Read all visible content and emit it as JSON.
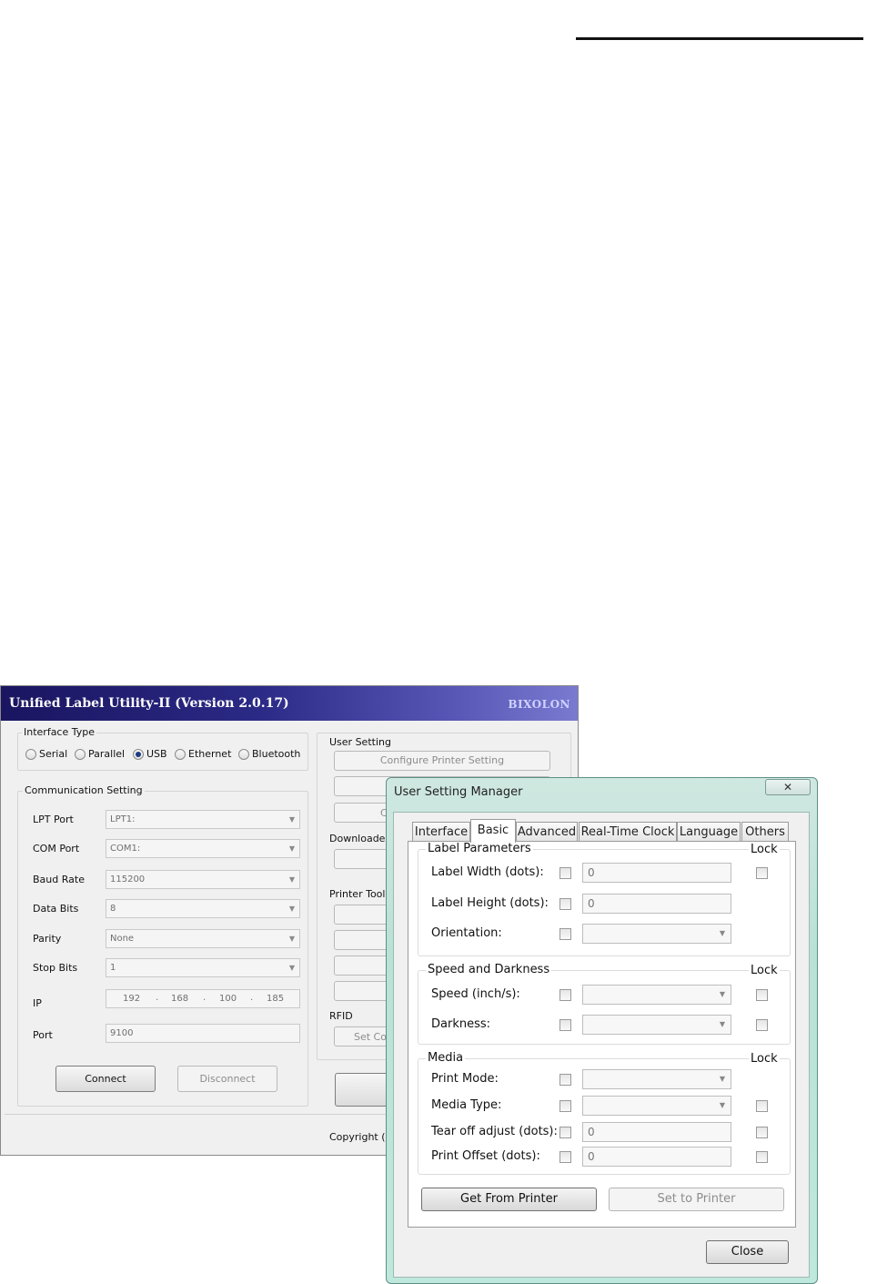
{
  "main_window": {
    "title": "Unified Label Utility-II (Version 2.0.17)",
    "brand": "BIXOLON",
    "interface_type": {
      "label": "Interface Type",
      "options": [
        "Serial",
        "Parallel",
        "USB",
        "Ethernet",
        "Bluetooth"
      ],
      "selected": "USB"
    },
    "communication": {
      "label": "Communication Setting",
      "lpt_port": {
        "label": "LPT Port",
        "value": "LPT1:"
      },
      "com_port": {
        "label": "COM Port",
        "value": "COM1:"
      },
      "baud_rate": {
        "label": "Baud Rate",
        "value": "115200"
      },
      "data_bits": {
        "label": "Data Bits",
        "value": "8"
      },
      "parity": {
        "label": "Parity",
        "value": "None"
      },
      "stop_bits": {
        "label": "Stop Bits",
        "value": "1"
      },
      "ip": {
        "label": "IP",
        "octets": [
          "192",
          "168",
          "100",
          "185"
        ],
        "sep": "."
      },
      "port": {
        "label": "Port",
        "value": "9100"
      },
      "connect": "Connect",
      "disconnect": "Disconnect"
    },
    "user_setting": {
      "label": "User Setting",
      "configure": "Configure Printer Setting",
      "partial": "C"
    },
    "downloader": {
      "label": "Downloader"
    },
    "printer_tool": {
      "label": "Printer Tool"
    },
    "rfid": {
      "label": "RFID",
      "set_partial": "Set Co"
    },
    "copyright_partial": "Copyright (C"
  },
  "dialog": {
    "title": "User Setting Manager",
    "close_glyph": "✕",
    "tabs": [
      "Interface",
      "Basic",
      "Advanced",
      "Real-Time Clock",
      "Language",
      "Others"
    ],
    "active_tab": "Basic",
    "lock": "Lock",
    "label_params": {
      "title": "Label Parameters",
      "label_width": {
        "label": "Label Width (dots):",
        "value": "0"
      },
      "label_height": {
        "label": "Label Height (dots):",
        "value": "0"
      },
      "orientation": {
        "label": "Orientation:"
      }
    },
    "speed_darkness": {
      "title": "Speed and Darkness",
      "speed": {
        "label": "Speed (inch/s):"
      },
      "darkness": {
        "label": "Darkness:"
      }
    },
    "media": {
      "title": "Media",
      "print_mode": {
        "label": "Print Mode:"
      },
      "media_type": {
        "label": "Media Type:"
      },
      "tear_off": {
        "label": "Tear off adjust (dots):",
        "value": "0"
      },
      "print_offset": {
        "label": "Print Offset (dots):",
        "value": "0"
      }
    },
    "get_from_printer": "Get From Printer",
    "set_to_printer": "Set to Printer",
    "close": "Close"
  }
}
